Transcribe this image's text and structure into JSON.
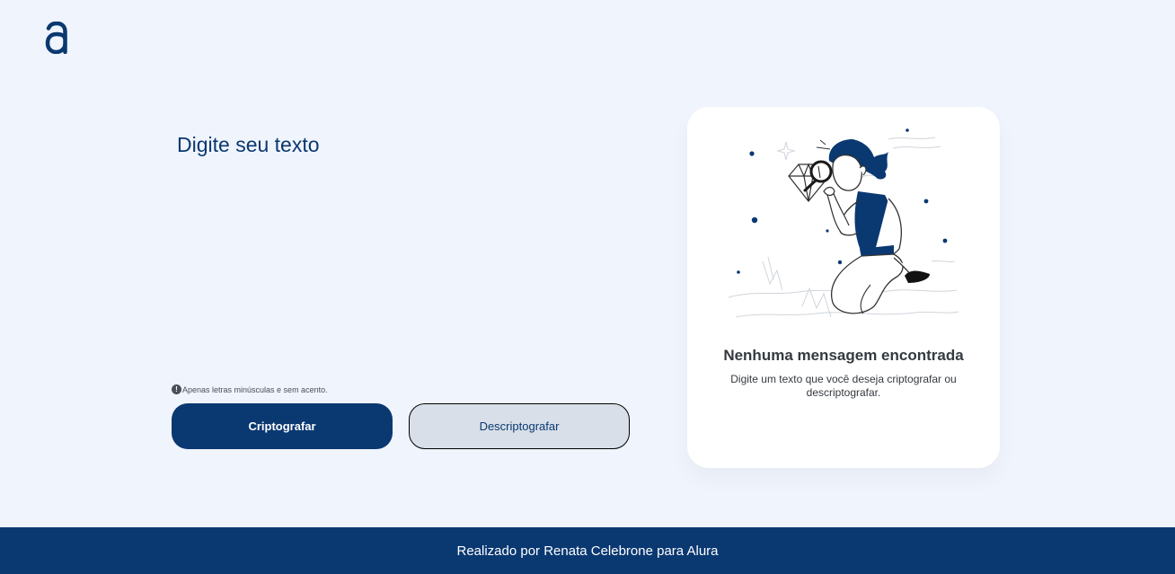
{
  "header": {
    "logo_icon": "alura-logo-icon"
  },
  "input": {
    "placeholder": "Digite seu texto",
    "value": ""
  },
  "notice": {
    "icon": "info-icon",
    "text": "Apenas letras minúsculas e sem acento."
  },
  "buttons": {
    "encrypt_label": "Criptografar",
    "decrypt_label": "Descriptografar"
  },
  "output": {
    "illustration": "person-with-magnifying-glass-illustration",
    "title": "Nenhuma mensagem encontrada",
    "text": "Digite um texto que você deseja criptografar ou descriptografar."
  },
  "footer": {
    "text": "Realizado por Renata Celebrone para Alura"
  },
  "colors": {
    "background": "#f0f4fc",
    "primary": "#0a3871",
    "secondary_button": "#d8dfe8",
    "card": "#ffffff",
    "text_dark": "#343a40"
  }
}
